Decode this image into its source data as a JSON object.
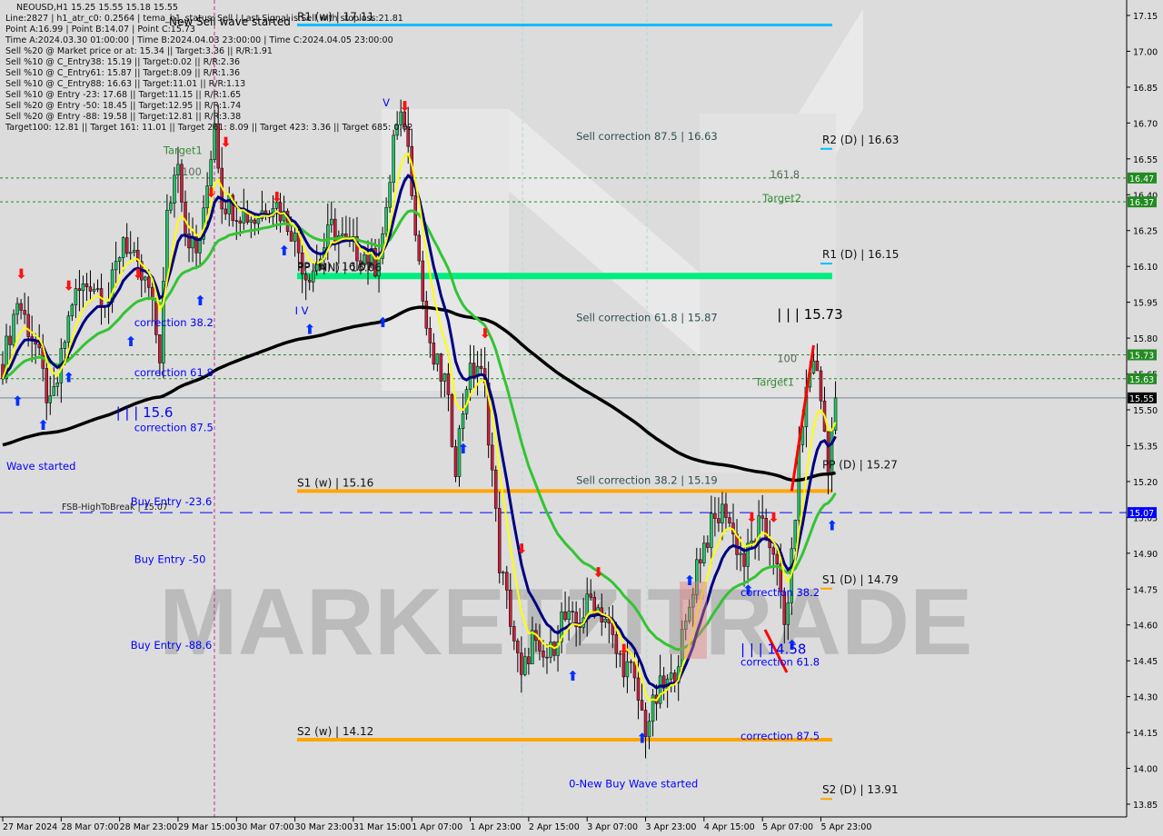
{
  "header": {
    "title": "NEOUSD,H1  15.25 15.55 15.18 15.55",
    "info_lines": [
      "Line:2827 | h1_atr_c0: 0.2564 | tema_h1_status: Sell | Last Signal is:Sell with stoploss:21.81",
      "Point A:16.99 | Point B:14.07 | Point C:15.73",
      "Time A:2024.03.30 01:00:00 | Time B:2024.04.03 23:00:00 | Time C:2024.04.05 23:00:00",
      "Sell %20 @ Market price or at: 15.34 || Target:3.36 || R/R:1.91",
      "Sell %10 @ C_Entry38: 15.19 || Target:0.02 || R/R:2.36",
      "Sell %10 @ C_Entry61: 15.87 || Target:8.09 || R/R:1.36",
      "Sell %10 @ C_Entry88: 16.63 || Target:11.01 || R/R:1.13",
      "Sell %10 @ Entry -23: 17.68 || Target:11.15 || R/R:1.65",
      "Sell %20 @ Entry -50: 18.45 || Target:12.95 || R/R:1.74",
      "Sell %20 @ Entry -88: 19.58 || Target:12.81 || R/R:3.38",
      "Target100: 12.81 || Target 161: 11.01 || Target 261: 8.09 || Target 423: 3.36 || Target 685: 0.02"
    ],
    "overlay_text": "New Sell wave started"
  },
  "watermark": "MARKETZITRADE",
  "chart_data": {
    "type": "candlestick",
    "symbol": "NEOUSD",
    "timeframe": "H1",
    "ohlc": {
      "open": 15.25,
      "high": 15.55,
      "low": 15.18,
      "close": 15.55
    },
    "ylim": [
      13.85,
      17.15
    ],
    "y_ticks": [
      "17.15",
      "17.00",
      "16.85",
      "16.70",
      "16.55",
      "16.40",
      "16.25",
      "16.10",
      "15.95",
      "15.80",
      "15.65",
      "15.50",
      "15.35",
      "15.20",
      "15.05",
      "14.90",
      "14.75",
      "14.60",
      "14.45",
      "14.30",
      "14.15",
      "14.00",
      "13.85"
    ],
    "x_ticks": [
      {
        "label": "27 Mar 2024",
        "t": "2024-03-27 15:00"
      },
      {
        "label": "28 Mar 07:00",
        "t": "2024-03-28 07:00"
      },
      {
        "label": "28 Mar 23:00",
        "t": "2024-03-28 23:00"
      },
      {
        "label": "29 Mar 15:00",
        "t": "2024-03-29 15:00"
      },
      {
        "label": "30 Mar 07:00",
        "t": "2024-03-30 07:00"
      },
      {
        "label": "30 Mar 23:00",
        "t": "2024-03-30 23:00"
      },
      {
        "label": "31 Mar 15:00",
        "t": "2024-03-31 15:00"
      },
      {
        "label": "1 Apr 07:00",
        "t": "2024-04-01 07:00"
      },
      {
        "label": "1 Apr 23:00",
        "t": "2024-04-01 23:00"
      },
      {
        "label": "2 Apr 15:00",
        "t": "2024-04-02 15:00"
      },
      {
        "label": "3 Apr 07:00",
        "t": "2024-04-03 07:00"
      },
      {
        "label": "3 Apr 23:00",
        "t": "2024-04-03 23:00"
      },
      {
        "label": "4 Apr 15:00",
        "t": "2024-04-04 15:00"
      },
      {
        "label": "5 Apr 07:00",
        "t": "2024-04-05 07:00"
      },
      {
        "label": "5 Apr 23:00",
        "t": "2024-04-05 23:00"
      }
    ],
    "price_path": [
      [
        "2024-03-27 15:00",
        15.69
      ],
      [
        "2024-03-27 19:00",
        15.96
      ],
      [
        "2024-03-28 00:00",
        15.77
      ],
      [
        "2024-03-28 04:00",
        15.5
      ],
      [
        "2024-03-28 06:00",
        15.62
      ],
      [
        "2024-03-28 10:00",
        15.96
      ],
      [
        "2024-03-28 15:00",
        16.04
      ],
      [
        "2024-03-28 20:00",
        15.96
      ],
      [
        "2024-03-29 00:00",
        16.23
      ],
      [
        "2024-03-29 04:00",
        16.07
      ],
      [
        "2024-03-29 07:00",
        16.0
      ],
      [
        "2024-03-29 10:00",
        15.73
      ],
      [
        "2024-03-29 12:00",
        16.3
      ],
      [
        "2024-03-29 15:00",
        16.57
      ],
      [
        "2024-03-29 17:00",
        16.26
      ],
      [
        "2024-03-29 20:00",
        16.15
      ],
      [
        "2024-03-29 22:00",
        16.3
      ],
      [
        "2024-03-30 01:00",
        16.72
      ],
      [
        "2024-03-30 03:00",
        16.38
      ],
      [
        "2024-03-30 07:00",
        16.34
      ],
      [
        "2024-03-30 12:00",
        16.3
      ],
      [
        "2024-03-30 17:00",
        16.38
      ],
      [
        "2024-03-30 22:00",
        16.26
      ],
      [
        "2024-03-31 02:00",
        16.07
      ],
      [
        "2024-03-31 05:00",
        16.11
      ],
      [
        "2024-03-31 09:00",
        16.26
      ],
      [
        "2024-03-31 13:00",
        16.19
      ],
      [
        "2024-03-31 18:00",
        16.15
      ],
      [
        "2024-03-31 21:00",
        16.11
      ],
      [
        "2024-04-01 00:00",
        16.3
      ],
      [
        "2024-04-01 02:00",
        16.64
      ],
      [
        "2024-04-01 05:00",
        16.72
      ],
      [
        "2024-04-01 07:00",
        16.45
      ],
      [
        "2024-04-01 10:00",
        15.96
      ],
      [
        "2024-04-01 12:00",
        15.73
      ],
      [
        "2024-04-01 16:00",
        15.62
      ],
      [
        "2024-04-01 19:00",
        15.28
      ],
      [
        "2024-04-01 22:00",
        15.62
      ],
      [
        "2024-04-02 01:00",
        15.69
      ],
      [
        "2024-04-02 03:00",
        15.58
      ],
      [
        "2024-04-02 05:00",
        15.24
      ],
      [
        "2024-04-02 07:00",
        14.86
      ],
      [
        "2024-04-02 10:00",
        14.63
      ],
      [
        "2024-04-02 13:00",
        14.36
      ],
      [
        "2024-04-02 16:00",
        14.55
      ],
      [
        "2024-04-02 18:00",
        14.44
      ],
      [
        "2024-04-02 21:00",
        14.48
      ],
      [
        "2024-04-03 00:00",
        14.63
      ],
      [
        "2024-04-03 04:00",
        14.59
      ],
      [
        "2024-04-03 08:00",
        14.71
      ],
      [
        "2024-04-03 12:00",
        14.63
      ],
      [
        "2024-04-03 15:00",
        14.48
      ],
      [
        "2024-04-03 19:00",
        14.4
      ],
      [
        "2024-04-03 23:00",
        14.17
      ],
      [
        "2024-04-04 03:00",
        14.33
      ],
      [
        "2024-04-04 06:00",
        14.36
      ],
      [
        "2024-04-04 10:00",
        14.59
      ],
      [
        "2024-04-04 13:00",
        14.86
      ],
      [
        "2024-04-04 17:00",
        15.01
      ],
      [
        "2024-04-04 21:00",
        15.09
      ],
      [
        "2024-04-04 23:00",
        14.97
      ],
      [
        "2024-04-05 02:00",
        14.86
      ],
      [
        "2024-04-05 06:00",
        15.01
      ],
      [
        "2024-04-05 10:00",
        14.93
      ],
      [
        "2024-04-05 13:00",
        14.59
      ],
      [
        "2024-04-05 15:00",
        14.86
      ],
      [
        "2024-04-05 17:00",
        15.31
      ],
      [
        "2024-04-05 19:00",
        15.58
      ],
      [
        "2024-04-05 21:00",
        15.73
      ],
      [
        "2024-04-05 23:00",
        15.54
      ],
      [
        "2024-04-06 01:00",
        15.28
      ],
      [
        "2024-04-06 03:00",
        15.55
      ]
    ],
    "dashed_levels": [
      {
        "price": 16.47,
        "tag": "16.47"
      },
      {
        "price": 16.37,
        "tag": "16.37"
      },
      {
        "price": 15.73,
        "tag": "15.73"
      },
      {
        "price": 15.63,
        "tag": "15.63"
      }
    ],
    "current_price": {
      "price": 15.55,
      "tag": "15.55"
    },
    "break_level": {
      "price": 15.07,
      "tag": "15.07",
      "label": "FSB-HighToBreak | 15.07"
    },
    "weekly_levels": [
      {
        "label": "R1 (w) | 17.11",
        "price": 17.11,
        "color": "#00bfff"
      },
      {
        "label": "PP (MN) | 16.06",
        "price": 16.06,
        "color": "#00ee80"
      },
      {
        "label": "S1 (w) | 15.16",
        "price": 15.16,
        "color": "#ffa500"
      },
      {
        "label": "S2 (w) | 14.12",
        "price": 14.12,
        "color": "#ffa500"
      }
    ],
    "pp_w_label": "PP (w) | 16.07",
    "daily_levels": [
      {
        "label": "R2 (D) | 16.63",
        "price": 16.63,
        "color": "#00bfff"
      },
      {
        "label": "R1 (D) | 16.15",
        "price": 16.15,
        "color": "#00bfff"
      },
      {
        "label": "PP (D) | 15.27",
        "price": 15.27,
        "color": "#30e090"
      },
      {
        "label": "S1 (D) | 14.79",
        "price": 14.79,
        "color": "#ffa500"
      },
      {
        "label": "S2 (D) | 13.91",
        "price": 13.91,
        "color": "#ffa500"
      }
    ],
    "annotations": [
      {
        "text": "Sell correction 87.5 | 16.63",
        "t": "2024-04-03 04:00",
        "price": 16.63,
        "color": "#2f4f4f"
      },
      {
        "text": "161.8",
        "t": "2024-04-05 09:00",
        "price": 16.47,
        "color": "#5a6a5a"
      },
      {
        "text": "Target2",
        "t": "2024-04-05 07:00",
        "price": 16.37,
        "color": "#3a8a3a"
      },
      {
        "text": "Sell correction 61.8 | 15.87",
        "t": "2024-04-03 04:00",
        "price": 15.87,
        "color": "#2f4f4f"
      },
      {
        "text": "| | | 15.73",
        "t": "2024-04-05 11:00",
        "price": 15.88,
        "color": "#000000",
        "big": true
      },
      {
        "text": "100",
        "t": "2024-04-05 11:00",
        "price": 15.7,
        "color": "#5a6a5a"
      },
      {
        "text": "Target1",
        "t": "2024-04-05 05:00",
        "price": 15.6,
        "color": "#3a8a3a"
      },
      {
        "text": "Sell correction 38.2 | 15.19",
        "t": "2024-04-03 04:00",
        "price": 15.19,
        "color": "#2f4f4f"
      },
      {
        "text": "correction 38.2",
        "t": "2024-04-05 01:00",
        "price": 14.72,
        "color": "#0000ff"
      },
      {
        "text": "| | | 14.58",
        "t": "2024-04-05 01:00",
        "price": 14.48,
        "color": "#0000ff",
        "big": true
      },
      {
        "text": "correction 61.8",
        "t": "2024-04-05 01:00",
        "price": 14.43,
        "color": "#0000ff"
      },
      {
        "text": "correction 87.5",
        "t": "2024-04-05 01:00",
        "price": 14.12,
        "color": "#0000ff"
      },
      {
        "text": "0-New Buy Wave started",
        "t": "2024-04-03 02:00",
        "price": 13.92,
        "color": "#0000ff"
      },
      {
        "text": "Target1",
        "t": "2024-03-29 11:00",
        "price": 16.57,
        "color": "#3a8a3a"
      },
      {
        "text": "100",
        "t": "2024-03-29 16:00",
        "price": 16.48,
        "color": "#5a6a5a"
      },
      {
        "text": "correction 38.2",
        "t": "2024-03-29 03:00",
        "price": 15.85,
        "color": "#0000ff"
      },
      {
        "text": "correction 61.8",
        "t": "2024-03-29 03:00",
        "price": 15.64,
        "color": "#0000ff"
      },
      {
        "text": "| | | 15.6",
        "t": "2024-03-28 22:00",
        "price": 15.47,
        "color": "#0000ff",
        "big": true
      },
      {
        "text": "correction 87.5",
        "t": "2024-03-29 03:00",
        "price": 15.41,
        "color": "#0000ff"
      },
      {
        "text": "Wave started",
        "t": "2024-03-27 16:00",
        "price": 15.25,
        "color": "#0000ff"
      },
      {
        "text": "Buy Entry -23.6",
        "t": "2024-03-29 02:00",
        "price": 15.1,
        "color": "#0000ff"
      },
      {
        "text": "Buy Entry -50",
        "t": "2024-03-29 03:00",
        "price": 14.86,
        "color": "#0000ff"
      },
      {
        "text": "Buy Entry -88.6",
        "t": "2024-03-29 02:00",
        "price": 14.5,
        "color": "#0000ff"
      },
      {
        "text": "I V",
        "t": "2024-03-30 23:00",
        "price": 15.9,
        "color": "#0000ff"
      },
      {
        "text": "V",
        "t": "2024-03-31 23:00",
        "price": 16.77,
        "color": "#0000ff"
      }
    ],
    "signals": [
      {
        "t": "2024-03-27 19:00",
        "price": 15.57,
        "dir": "up"
      },
      {
        "t": "2024-03-28 02:00",
        "price": 15.47,
        "dir": "up"
      },
      {
        "t": "2024-03-28 09:00",
        "price": 15.67,
        "dir": "up"
      },
      {
        "t": "2024-03-29 02:00",
        "price": 15.82,
        "dir": "up"
      },
      {
        "t": "2024-03-29 21:00",
        "price": 15.99,
        "dir": "up"
      },
      {
        "t": "2024-03-30 20:00",
        "price": 16.2,
        "dir": "up"
      },
      {
        "t": "2024-03-31 03:00",
        "price": 15.87,
        "dir": "up"
      },
      {
        "t": "2024-03-31 23:00",
        "price": 15.9,
        "dir": "up"
      },
      {
        "t": "2024-04-01 21:00",
        "price": 15.37,
        "dir": "up"
      },
      {
        "t": "2024-04-03 03:00",
        "price": 14.42,
        "dir": "up"
      },
      {
        "t": "2024-04-03 22:00",
        "price": 14.16,
        "dir": "up"
      },
      {
        "t": "2024-04-04 11:00",
        "price": 14.82,
        "dir": "up"
      },
      {
        "t": "2024-04-05 03:00",
        "price": 14.78,
        "dir": "up"
      },
      {
        "t": "2024-04-05 15:00",
        "price": 14.55,
        "dir": "up"
      },
      {
        "t": "2024-04-06 02:00",
        "price": 15.05,
        "dir": "up"
      },
      {
        "t": "2024-03-27 20:00",
        "price": 16.05,
        "dir": "down"
      },
      {
        "t": "2024-03-28 09:00",
        "price": 16.0,
        "dir": "down"
      },
      {
        "t": "2024-03-29 04:00",
        "price": 16.05,
        "dir": "down"
      },
      {
        "t": "2024-03-30 00:00",
        "price": 16.39,
        "dir": "down"
      },
      {
        "t": "2024-03-30 04:00",
        "price": 16.6,
        "dir": "down"
      },
      {
        "t": "2024-03-30 18:00",
        "price": 16.37,
        "dir": "down"
      },
      {
        "t": "2024-04-01 05:00",
        "price": 16.75,
        "dir": "down"
      },
      {
        "t": "2024-04-02 03:00",
        "price": 15.8,
        "dir": "down"
      },
      {
        "t": "2024-04-02 13:00",
        "price": 14.9,
        "dir": "down"
      },
      {
        "t": "2024-04-03 10:00",
        "price": 14.8,
        "dir": "down"
      },
      {
        "t": "2024-04-03 17:00",
        "price": 14.48,
        "dir": "down"
      },
      {
        "t": "2024-04-05 04:00",
        "price": 15.03,
        "dir": "down"
      },
      {
        "t": "2024-04-05 10:00",
        "price": 15.03,
        "dir": "down"
      }
    ],
    "colors": {
      "bull": "#22c466",
      "bear": "#c8203c",
      "ema_fast": "#ffff00",
      "ema_mid": "#00007f",
      "ema_slow": "#33c433",
      "ema_long": "#000000",
      "bg": "#dcdcdc"
    }
  }
}
